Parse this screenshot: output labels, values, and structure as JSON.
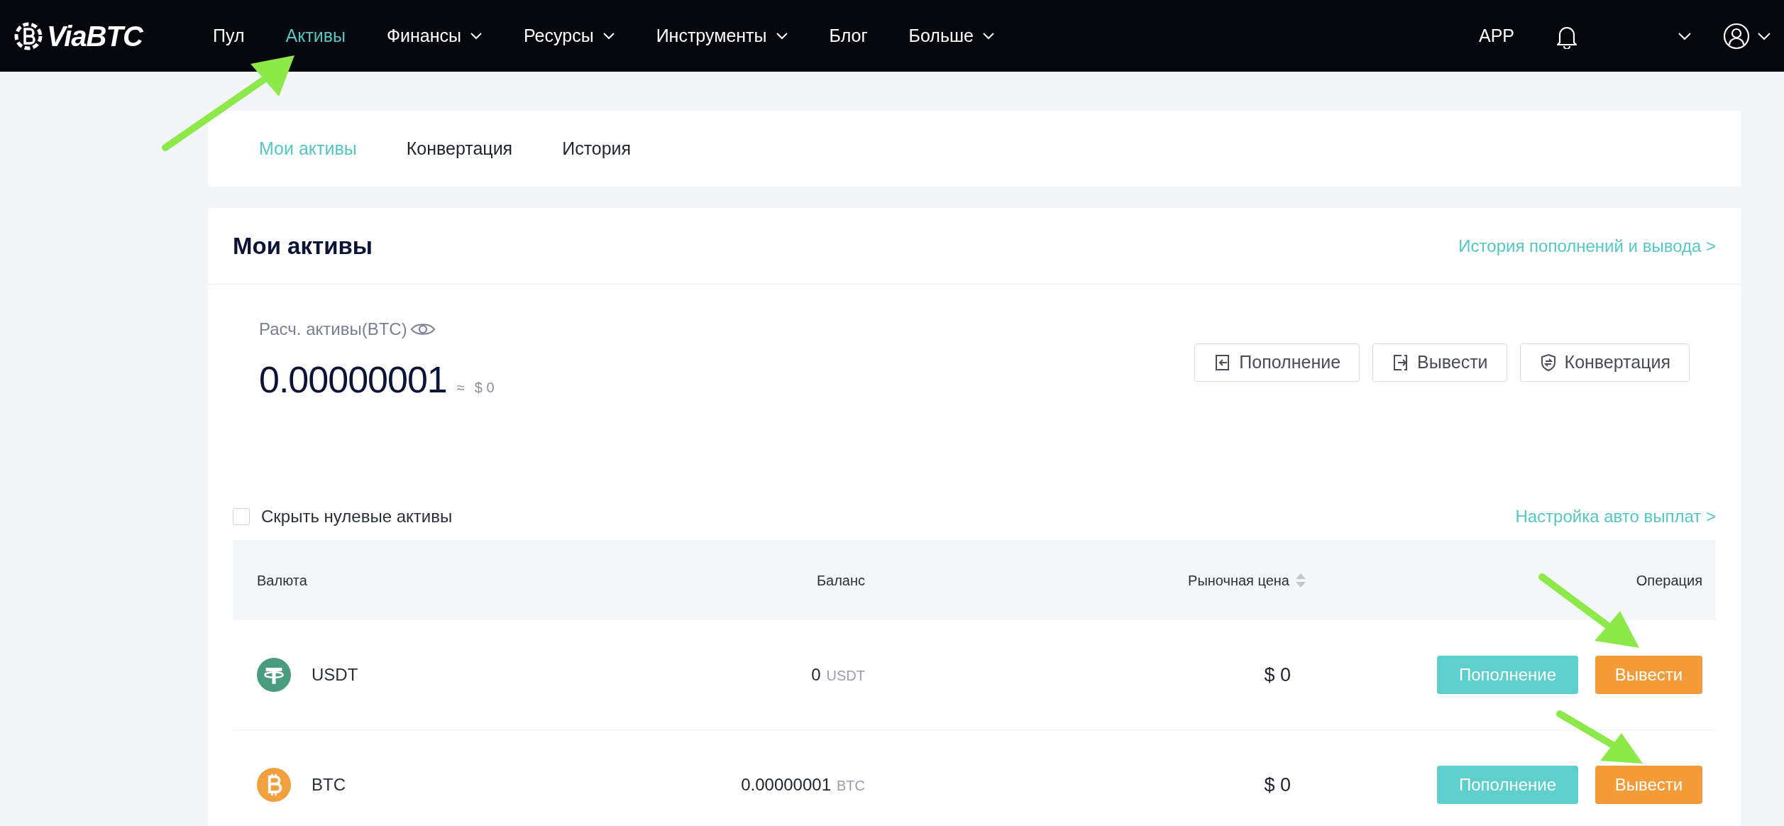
{
  "navbar": {
    "logo": "ViaBTC",
    "items": [
      {
        "label": "Пул",
        "selected": false,
        "dropdown": false
      },
      {
        "label": "Активы",
        "selected": true,
        "dropdown": false
      },
      {
        "label": "Финансы",
        "selected": false,
        "dropdown": true
      },
      {
        "label": "Ресурсы",
        "selected": false,
        "dropdown": true
      },
      {
        "label": "Инструменты",
        "selected": false,
        "dropdown": true
      },
      {
        "label": "Блог",
        "selected": false,
        "dropdown": false
      },
      {
        "label": "Больше",
        "selected": false,
        "dropdown": true
      }
    ],
    "app": "APP"
  },
  "tabs": [
    {
      "label": "Мои активы",
      "selected": true
    },
    {
      "label": "Конвертация",
      "selected": false
    },
    {
      "label": "История",
      "selected": false
    }
  ],
  "assets": {
    "title": "Мои активы",
    "history_link": "История пополнений и вывода >",
    "estimate_label": "Расч. активы(BTC)",
    "estimate_value": "0.00000001",
    "approx": "≈",
    "usd_value": "$ 0",
    "actions": [
      {
        "kind": "deposit",
        "label": "Пополнение"
      },
      {
        "kind": "withdraw",
        "label": "Вывести"
      },
      {
        "kind": "convert",
        "label": "Конвертация"
      }
    ]
  },
  "hide_zero": {
    "label": "Скрыть нулевые активы",
    "checked": false
  },
  "auto_payout_link": "Настройка авто выплат >",
  "table": {
    "columns": [
      "Валюта",
      "Баланс",
      "Рыночная цена",
      "Операция"
    ],
    "rows": [
      {
        "kind": "usdt",
        "coin": "USDT",
        "balance": "0",
        "unit": "USDT",
        "price": "$ 0",
        "deposit": "Пополнение",
        "withdraw": "Вывести"
      },
      {
        "kind": "btc",
        "coin": "BTC",
        "balance": "0.00000001",
        "unit": "BTC",
        "price": "$ 0",
        "deposit": "Пополнение",
        "withdraw": "Вывести"
      }
    ]
  }
}
